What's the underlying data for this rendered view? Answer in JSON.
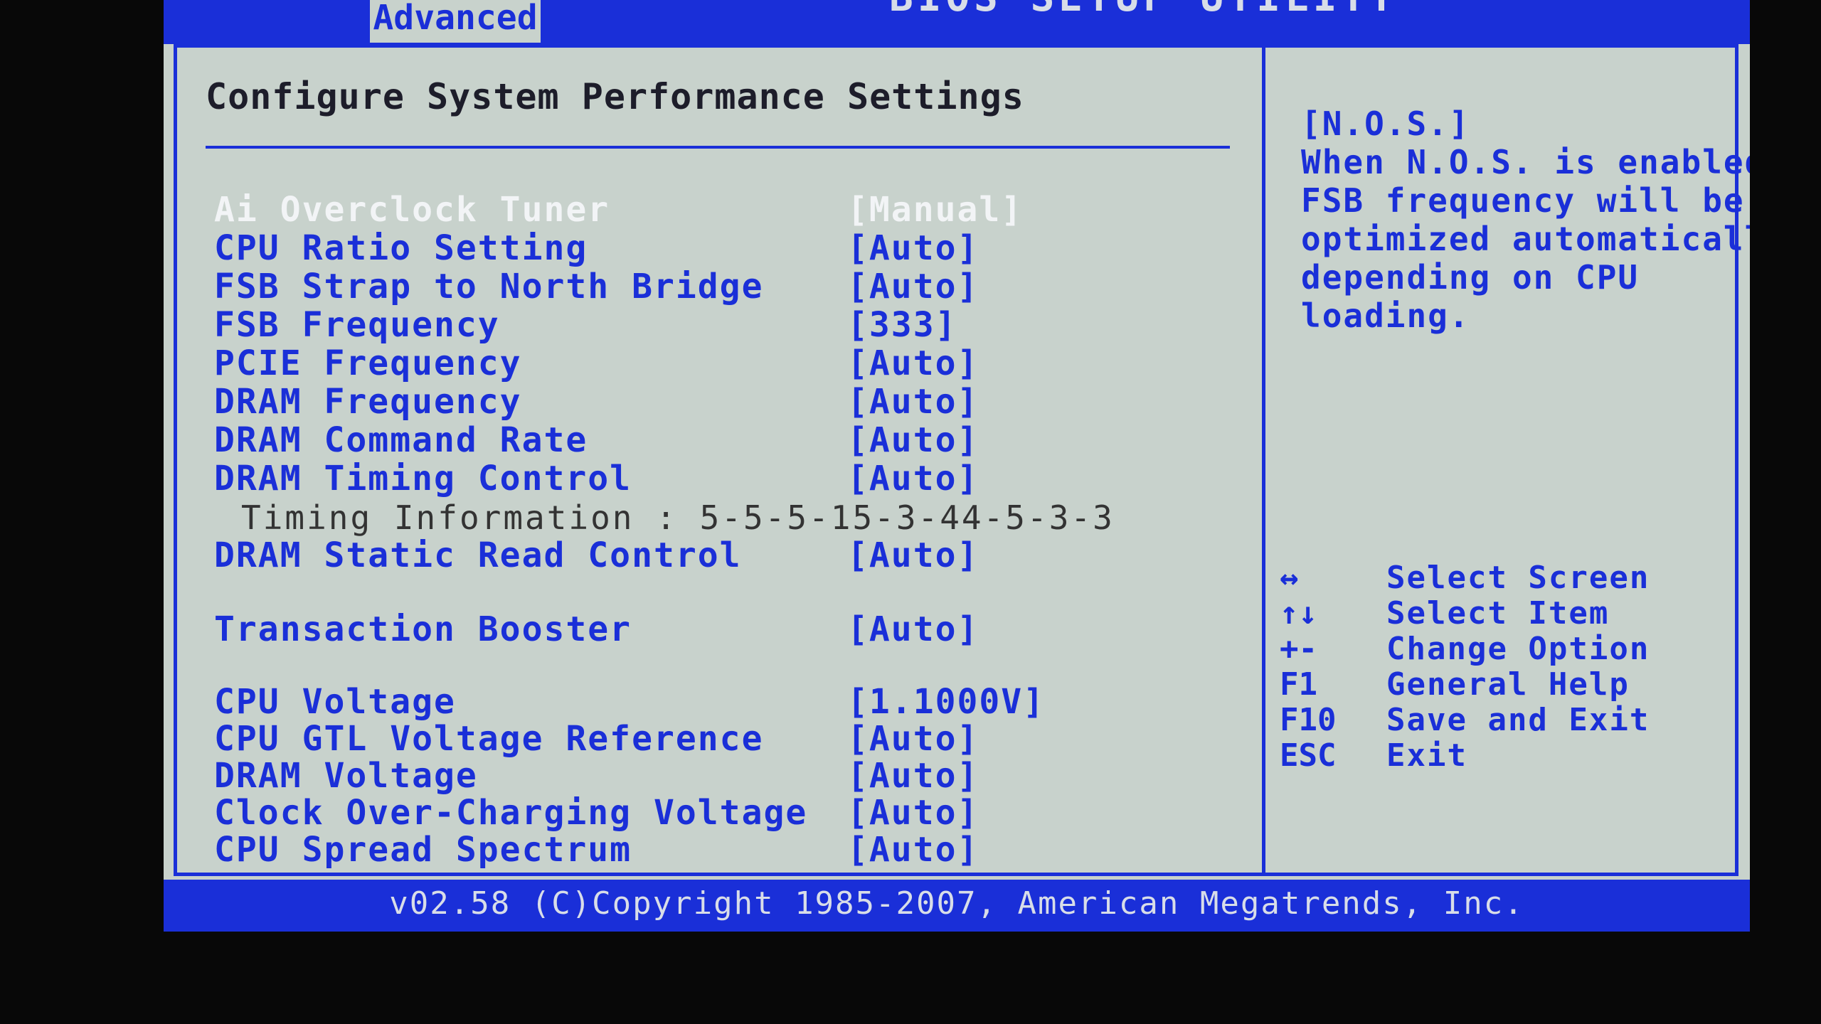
{
  "header": {
    "utility_title": "BIOS SETUP UTILITY",
    "active_tab": "Advanced"
  },
  "page_title": "Configure System Performance Settings",
  "settings": [
    {
      "label": "Ai Overclock Tuner",
      "value": "[Manual]"
    },
    {
      "label": "CPU Ratio Setting",
      "value": "[Auto]"
    },
    {
      "label": "FSB Strap to North Bridge",
      "value": "[Auto]"
    },
    {
      "label": "FSB Frequency",
      "value": "[333]"
    },
    {
      "label": "PCIE Frequency",
      "value": "[Auto]"
    },
    {
      "label": "DRAM Frequency",
      "value": "[Auto]"
    },
    {
      "label": "DRAM Command Rate",
      "value": "[Auto]"
    },
    {
      "label": "DRAM Timing Control",
      "value": "[Auto]"
    },
    {
      "label": "DRAM Static Read Control",
      "value": "[Auto]"
    },
    {
      "label": "Transaction Booster",
      "value": "[Auto]"
    },
    {
      "label": "CPU Voltage",
      "value": "[1.1000V]"
    },
    {
      "label": "CPU GTL Voltage Reference",
      "value": "[Auto]"
    },
    {
      "label": "DRAM Voltage",
      "value": "[Auto]"
    },
    {
      "label": "Clock Over-Charging Voltage",
      "value": "[Auto]"
    },
    {
      "label": "CPU Spread Spectrum",
      "value": "[Auto]"
    }
  ],
  "timing_info": "Timing Information : 5-5-5-15-3-44-5-3-3",
  "help": {
    "title": "[N.O.S.]",
    "lines": [
      "When N.O.S. is enabled",
      "FSB frequency will be",
      "optimized automaticall",
      "depending on CPU",
      "loading."
    ]
  },
  "keys": [
    {
      "key": "↔",
      "desc": "Select Screen"
    },
    {
      "key": "↑↓",
      "desc": "Select Item"
    },
    {
      "key": "+-",
      "desc": "Change Option"
    },
    {
      "key": "F1",
      "desc": "General Help"
    },
    {
      "key": "F10",
      "desc": "Save and Exit"
    },
    {
      "key": "ESC",
      "desc": "Exit"
    }
  ],
  "footer": "v02.58 (C)Copyright 1985-2007, American Megatrends, Inc.",
  "colors": {
    "background": "#c8d2cc",
    "accent": "#1a2fd8",
    "selected_text": "#f2f4f6"
  }
}
